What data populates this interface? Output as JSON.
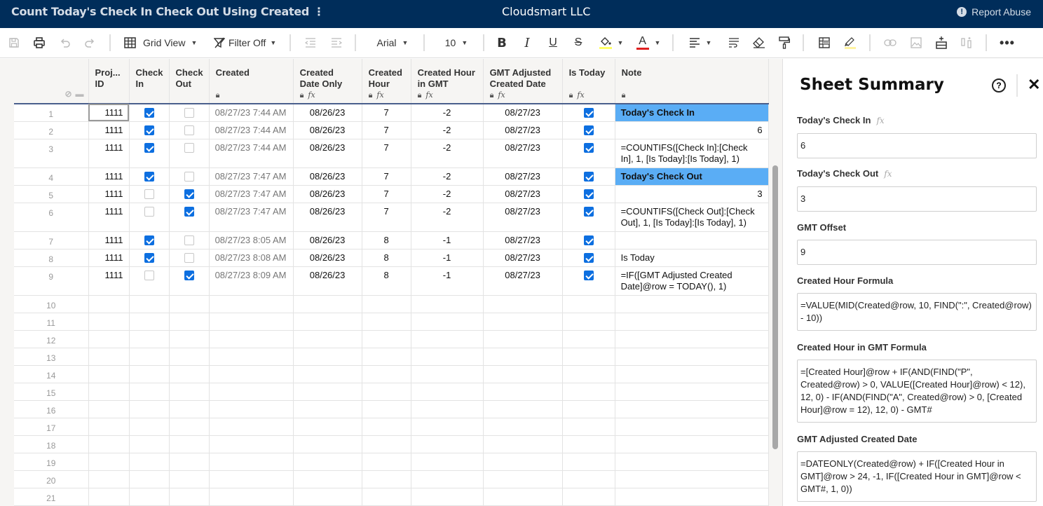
{
  "header": {
    "sheet_title": "Count Today's Check In Check Out Using Created",
    "menu_icon": "vertical-ellipsis",
    "org_name": "Cloudsmart LLC",
    "report_abuse_label": "Report Abuse"
  },
  "toolbar": {
    "view_label": "Grid View",
    "filter_label": "Filter Off",
    "font_label": "Arial",
    "font_size_label": "10",
    "fill_color": "#ffff66",
    "text_color": "#e02020",
    "highlight_color": "#fff3a0"
  },
  "grid": {
    "columns": [
      {
        "label": "Proj... ID",
        "locked": false,
        "formula": false
      },
      {
        "label": "Check In",
        "locked": false,
        "formula": false
      },
      {
        "label": "Check Out",
        "locked": false,
        "formula": false
      },
      {
        "label": "Created",
        "locked": true,
        "formula": false
      },
      {
        "label": "Created Date Only",
        "locked": true,
        "formula": true
      },
      {
        "label": "Created Hour",
        "locked": true,
        "formula": true
      },
      {
        "label": "Created Hour in GMT",
        "locked": true,
        "formula": true
      },
      {
        "label": "GMT Adjusted Created Date",
        "locked": true,
        "formula": true
      },
      {
        "label": "Is Today",
        "locked": true,
        "formula": true
      },
      {
        "label": "Note",
        "locked": true,
        "formula": false
      }
    ],
    "rows": [
      {
        "num": "1",
        "proj_id": "1111",
        "check_in": true,
        "check_out": false,
        "created": "08/27/23 7:44 AM",
        "date_only": "08/26/23",
        "hour": "7",
        "hour_gmt": "-2",
        "gmt_date": "08/27/23",
        "is_today": true,
        "note": "Today's Check In",
        "note_style": "hl"
      },
      {
        "num": "2",
        "proj_id": "1111",
        "check_in": true,
        "check_out": false,
        "created": "08/27/23 7:44 AM",
        "date_only": "08/26/23",
        "hour": "7",
        "hour_gmt": "-2",
        "gmt_date": "08/27/23",
        "is_today": true,
        "note": "6",
        "note_style": "right"
      },
      {
        "num": "3",
        "proj_id": "1111",
        "check_in": true,
        "check_out": false,
        "created": "08/27/23 7:44 AM",
        "date_only": "08/26/23",
        "hour": "7",
        "hour_gmt": "-2",
        "gmt_date": "08/27/23",
        "is_today": true,
        "note": "=COUNTIFS([Check In]:[Check In], 1, [Is Today]:[Is Today], 1)",
        "note_style": "tall"
      },
      {
        "num": "4",
        "proj_id": "1111",
        "check_in": true,
        "check_out": false,
        "created": "08/27/23 7:47 AM",
        "date_only": "08/26/23",
        "hour": "7",
        "hour_gmt": "-2",
        "gmt_date": "08/27/23",
        "is_today": true,
        "note": "Today's Check Out",
        "note_style": "hl"
      },
      {
        "num": "5",
        "proj_id": "1111",
        "check_in": false,
        "check_out": true,
        "created": "08/27/23 7:47 AM",
        "date_only": "08/26/23",
        "hour": "7",
        "hour_gmt": "-2",
        "gmt_date": "08/27/23",
        "is_today": true,
        "note": "3",
        "note_style": "right"
      },
      {
        "num": "6",
        "proj_id": "1111",
        "check_in": false,
        "check_out": true,
        "created": "08/27/23 7:47 AM",
        "date_only": "08/26/23",
        "hour": "7",
        "hour_gmt": "-2",
        "gmt_date": "08/27/23",
        "is_today": true,
        "note": "=COUNTIFS([Check Out]:[Check Out], 1, [Is Today]:[Is Today], 1)",
        "note_style": "tall"
      },
      {
        "num": "7",
        "proj_id": "1111",
        "check_in": true,
        "check_out": false,
        "created": "08/27/23 8:05 AM",
        "date_only": "08/26/23",
        "hour": "8",
        "hour_gmt": "-1",
        "gmt_date": "08/27/23",
        "is_today": true,
        "note": "",
        "note_style": ""
      },
      {
        "num": "8",
        "proj_id": "1111",
        "check_in": true,
        "check_out": false,
        "created": "08/27/23 8:08 AM",
        "date_only": "08/26/23",
        "hour": "8",
        "hour_gmt": "-1",
        "gmt_date": "08/27/23",
        "is_today": true,
        "note": "Is Today",
        "note_style": ""
      },
      {
        "num": "9",
        "proj_id": "1111",
        "check_in": false,
        "check_out": true,
        "created": "08/27/23 8:09 AM",
        "date_only": "08/26/23",
        "hour": "8",
        "hour_gmt": "-1",
        "gmt_date": "08/27/23",
        "is_today": true,
        "note": "=IF([GMT Adjusted Created Date]@row = TODAY(), 1)",
        "note_style": "tall"
      }
    ],
    "empty_row_numbers": [
      "10",
      "11",
      "12",
      "13",
      "14",
      "15",
      "16",
      "17",
      "18",
      "19",
      "20",
      "21"
    ]
  },
  "summary_panel": {
    "title": "Sheet Summary",
    "fields": [
      {
        "label": "Today's Check In",
        "formula": true,
        "value": "6"
      },
      {
        "label": "Today's Check Out",
        "formula": true,
        "value": "3"
      },
      {
        "label": "GMT Offset",
        "formula": false,
        "value": "9"
      },
      {
        "label": "Created Hour Formula",
        "formula": false,
        "value": "=VALUE(MID(Created@row, 10, FIND(\":\", Created@row) - 10))"
      },
      {
        "label": "Created Hour in GMT Formula",
        "formula": false,
        "value": "=[Created Hour]@row + IF(AND(FIND(\"P\", Created@row) > 0, VALUE([Created Hour]@row) < 12), 12, 0) - IF(AND(FIND(\"A\", Created@row) > 0, [Created Hour]@row = 12), 12, 0) - GMT#"
      },
      {
        "label": "GMT Adjusted Created Date",
        "formula": false,
        "value": "=DATEONLY(Created@row) + IF([Created Hour in GMT]@row > 24, -1, IF([Created Hour in GMT]@row < GMT#, 1, 0))"
      }
    ]
  }
}
